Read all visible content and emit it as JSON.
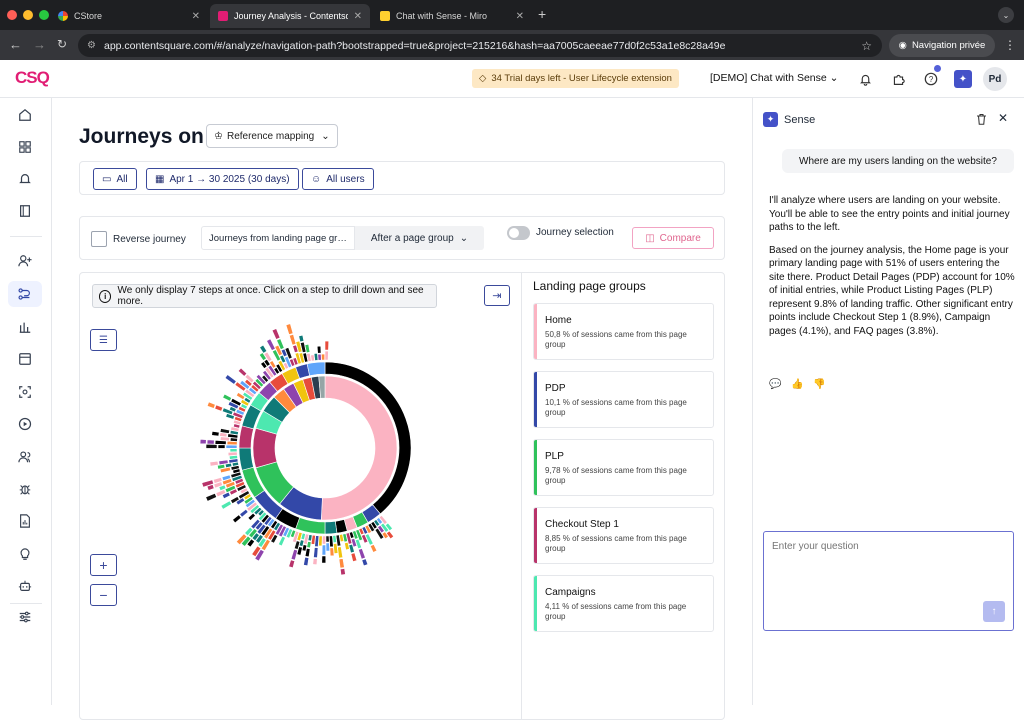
{
  "browser": {
    "tabs": [
      {
        "title": "CStore",
        "color": "#f4b400"
      },
      {
        "title": "Journey Analysis - Contentsq…",
        "color": "#e11d74"
      },
      {
        "title": "Chat with Sense - Miro",
        "color": "#ffd02f"
      }
    ],
    "url": "app.contentsquare.com/#/analyze/navigation-path?bootstrapped=true&project=215216&hash=aa7005caeeae77d0f2c53a1e8c28a49e",
    "private_label": "Navigation privée"
  },
  "header": {
    "logo": "CSQ",
    "trial": "34 Trial days left - User Lifecycle extension",
    "workspace": "[DEMO] Chat with Sense",
    "avatar": "Pd"
  },
  "main": {
    "title": "Journeys on",
    "mapping": "Reference mapping",
    "filters": {
      "segment": "All",
      "dates": "Apr 1 → 30 2025 (30 days)",
      "users": "All users"
    },
    "controls": {
      "reverse": "Reverse journey",
      "journey_from": "Journeys from landing page gr…",
      "after": "After a page group",
      "journey_selection": "Journey selection",
      "compare": "Compare"
    },
    "info": "We only display 7 steps at once. Click on a step to drill down and see more."
  },
  "landing": {
    "title": "Landing page groups",
    "groups": [
      {
        "name": "Home",
        "desc": "50,8 % of sessions came from this page group",
        "color": "#fbb3c2"
      },
      {
        "name": "PDP",
        "desc": "10,1 % of sessions came from this page group",
        "color": "#3348a8"
      },
      {
        "name": "PLP",
        "desc": "9,78 % of sessions came from this page group",
        "color": "#2fc25b"
      },
      {
        "name": "Checkout Step 1",
        "desc": "8,85 % of sessions came from this page group",
        "color": "#b8336a"
      },
      {
        "name": "Campaigns",
        "desc": "4,11 % of sessions came from this page group",
        "color": "#4de8b0"
      }
    ]
  },
  "sense": {
    "title": "Sense",
    "question": "Where are my users landing on the website?",
    "answer_p1": "I'll analyze where users are landing on your website. You'll be able to see the entry points and initial journey paths to the left.",
    "answer_p2": "Based on the journey analysis, the Home page is your primary landing page with 51% of users entering the site there. Product Detail Pages (PDP) account for 10% of initial entries, while Product Listing Pages (PLP) represent 9.8% of landing traffic. Other significant entry points include Checkout Step 1 (8.9%), Campaign pages (4.1%), and FAQ pages (3.8%).",
    "placeholder": "Enter your question"
  }
}
